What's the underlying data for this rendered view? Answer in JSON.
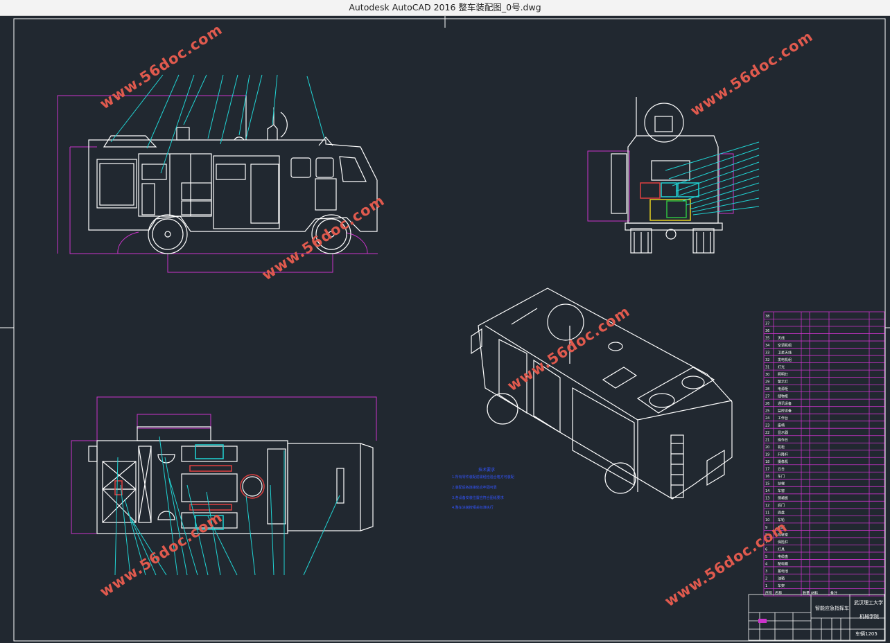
{
  "window": {
    "app_name": "Autodesk AutoCAD 2016",
    "file_name": "整车装配图_0号.dwg"
  },
  "watermark": {
    "text": "www.56doc.com"
  },
  "technical_requirements": {
    "title": "技术要求",
    "lines": [
      "1.所有零件装配前需经检验合格方可装配",
      "2.装配后各连接处应牢固可靠",
      "3.各设备安装位置应符合图纸要求",
      "4.整车涂装按相关标准执行"
    ]
  },
  "parts_list": {
    "rows": [
      {
        "no": "38",
        "name": ""
      },
      {
        "no": "37",
        "name": ""
      },
      {
        "no": "36",
        "name": ""
      },
      {
        "no": "35",
        "name": "天线"
      },
      {
        "no": "34",
        "name": "空调机组"
      },
      {
        "no": "33",
        "name": "卫星天线"
      },
      {
        "no": "32",
        "name": "发电机组"
      },
      {
        "no": "31",
        "name": "灯光"
      },
      {
        "no": "30",
        "name": "照明灯"
      },
      {
        "no": "29",
        "name": "警示灯"
      },
      {
        "no": "28",
        "name": "电源柜"
      },
      {
        "no": "27",
        "name": "储物柜"
      },
      {
        "no": "26",
        "name": "通讯设备"
      },
      {
        "no": "25",
        "name": "监控设备"
      },
      {
        "no": "24",
        "name": "工作台"
      },
      {
        "no": "23",
        "name": "座椅"
      },
      {
        "no": "22",
        "name": "显示器"
      },
      {
        "no": "21",
        "name": "操作台"
      },
      {
        "no": "20",
        "name": "机柜"
      },
      {
        "no": "19",
        "name": "升降杆"
      },
      {
        "no": "18",
        "name": "摄像机"
      },
      {
        "no": "17",
        "name": "云台"
      },
      {
        "no": "16",
        "name": "车门"
      },
      {
        "no": "15",
        "name": "扶梯"
      },
      {
        "no": "14",
        "name": "车窗"
      },
      {
        "no": "13",
        "name": "侧裙板"
      },
      {
        "no": "12",
        "name": "后门"
      },
      {
        "no": "11",
        "name": "底盘"
      },
      {
        "no": "10",
        "name": "车轮"
      },
      {
        "no": "9",
        "name": "车厢"
      },
      {
        "no": "8",
        "name": "驾驶室"
      },
      {
        "no": "7",
        "name": "保险杠"
      },
      {
        "no": "6",
        "name": "灯具"
      },
      {
        "no": "5",
        "name": "电缆盘"
      },
      {
        "no": "4",
        "name": "配电箱"
      },
      {
        "no": "3",
        "name": "蓄电池"
      },
      {
        "no": "2",
        "name": "油箱"
      },
      {
        "no": "1",
        "name": "车架"
      }
    ],
    "footer": [
      "序号",
      "名称",
      "数量",
      "材料",
      "备注"
    ]
  },
  "title_block": {
    "drawing_name": "智能应急指挥车",
    "school": "武汉理工大学",
    "dept": "机械学院",
    "class": "车辆1205"
  },
  "colors": {
    "background": "#212830",
    "geometry": "#ffffff",
    "leader": "#21d4d4",
    "border": "#cc33cc",
    "note_text": "#3355ff",
    "watermark": "#e05a4e",
    "titlebar": "#f3f3f3"
  }
}
